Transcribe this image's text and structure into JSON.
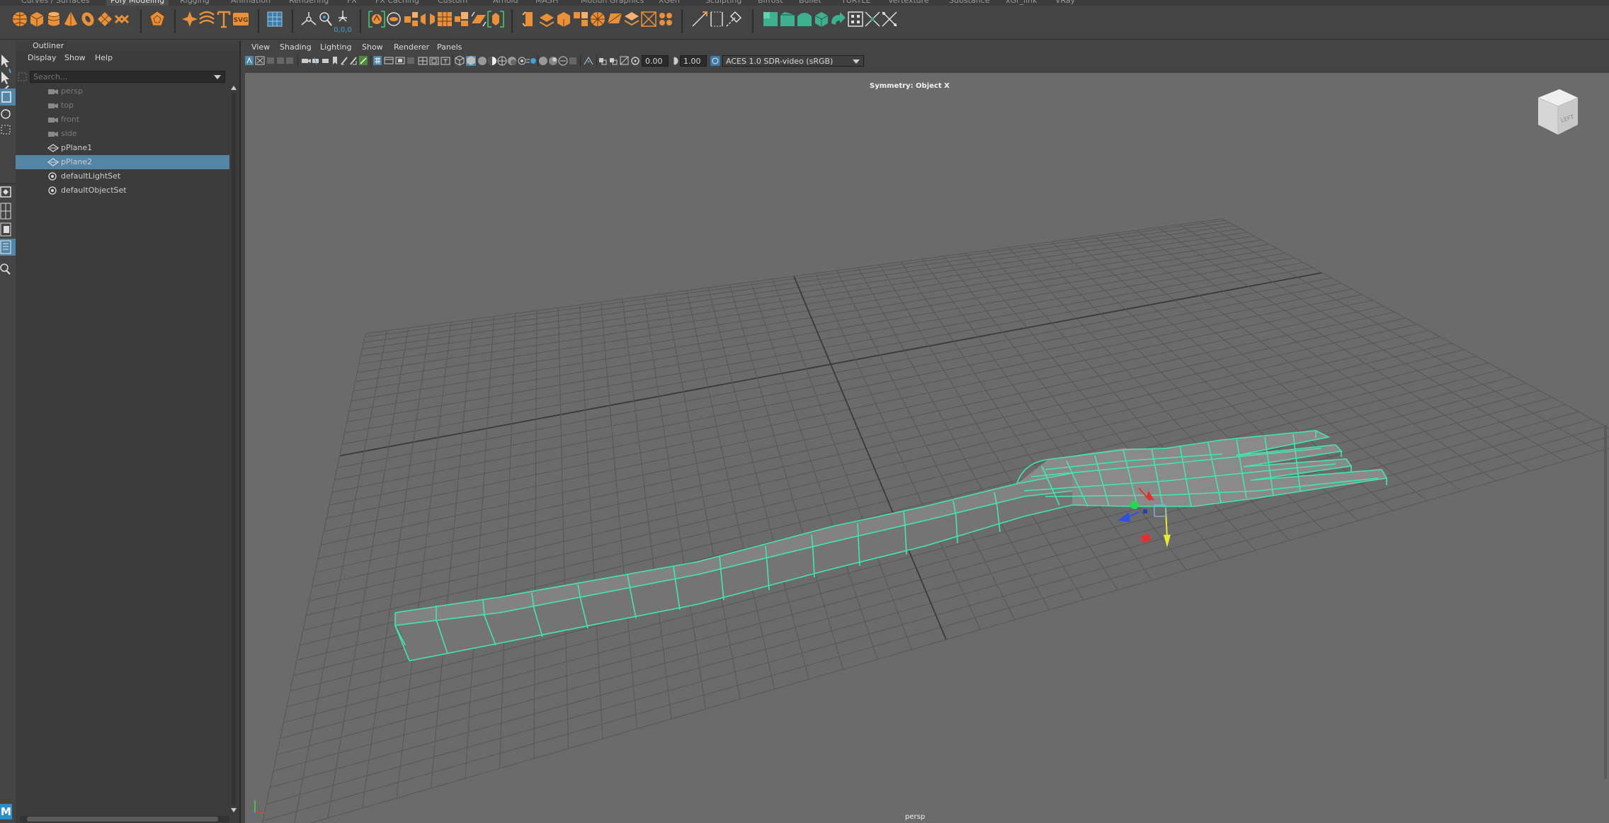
{
  "shelf_tabs": [
    "Curves / Surfaces",
    "Poly Modeling",
    "Rigging",
    "Animation",
    "Rendering",
    "FX",
    "FX Caching",
    "Custom",
    "Arnold",
    "MASH",
    "Motion Graphics",
    "XGen",
    "Sculpting",
    "Bifrost",
    "Bullet",
    "TURTLE",
    "Vertexture",
    "Substance",
    "xGr_link",
    "VRay"
  ],
  "shelf_active_tab": "Poly Modeling",
  "shelf_icons": [
    "poly-sphere-icon",
    "poly-cube-icon",
    "poly-cylinder-icon",
    "poly-cone-icon",
    "poly-torus-icon",
    "poly-plane-icon",
    "poly-disc-icon",
    "platonic-icon",
    "super-shape-icon",
    "sweep-mesh-icon",
    "type-icon",
    "svg-icon",
    "sculpt-grid-icon",
    "target-weld-icon",
    "center-pivot-icon",
    "move-origin-icon",
    "combine-icon",
    "separate-icon",
    "smooth-icon",
    "extract-icon",
    "boolean-icon",
    "mirror-icon",
    "bevel-icon",
    "bridge-icon",
    "extrude-icon",
    "fill-hole-icon",
    "merge-icon",
    "collapse-icon",
    "circularize-icon",
    "wedge-icon",
    "poke-icon",
    "reduce-icon",
    "multi-cut-icon",
    "insert-edge-loop-icon",
    "offset-loop-icon",
    "face-normals-icon",
    "soften-edge-icon",
    "harden-edge-icon",
    "normals-icon",
    "reverse-icon",
    "conform-icon",
    "transfer-attributes-icon",
    "weld-icon",
    "unfold-icon"
  ],
  "shelf_num_label": "0,0,0",
  "outliner": {
    "title": "Outliner",
    "menu": [
      "Display",
      "Show",
      "Help"
    ],
    "search_placeholder": "Search...",
    "items": [
      {
        "label": "persp",
        "icon": "camera-icon",
        "dim": true,
        "selected": false
      },
      {
        "label": "top",
        "icon": "camera-icon",
        "dim": true,
        "selected": false
      },
      {
        "label": "front",
        "icon": "camera-icon",
        "dim": true,
        "selected": false
      },
      {
        "label": "side",
        "icon": "camera-icon",
        "dim": true,
        "selected": false
      },
      {
        "label": "pPlane1",
        "icon": "mesh-icon",
        "dim": false,
        "selected": false
      },
      {
        "label": "pPlane2",
        "icon": "mesh-icon",
        "dim": false,
        "selected": true
      },
      {
        "label": "defaultLightSet",
        "icon": "set-icon",
        "dim": false,
        "selected": false
      },
      {
        "label": "defaultObjectSet",
        "icon": "set-icon",
        "dim": false,
        "selected": false
      }
    ]
  },
  "viewport": {
    "menu": [
      "View",
      "Shading",
      "Lighting",
      "Show",
      "Renderer",
      "Panels"
    ],
    "exposure_value": "0.00",
    "gamma_value": "1.00",
    "color_space": "ACES 1.0 SDR-video (sRGB)",
    "symmetry_label": "Symmetry: Object X",
    "camera_label": "persp",
    "viewcube_label": "LEFT"
  },
  "colors": {
    "accent_selected": "#5285a6",
    "wire_selected": "#43e6b0",
    "shelf_orange": "#e8913a",
    "shelf_green": "#3fb08f",
    "viewport_bg": "#6b6b6b"
  },
  "app_logo": "M"
}
